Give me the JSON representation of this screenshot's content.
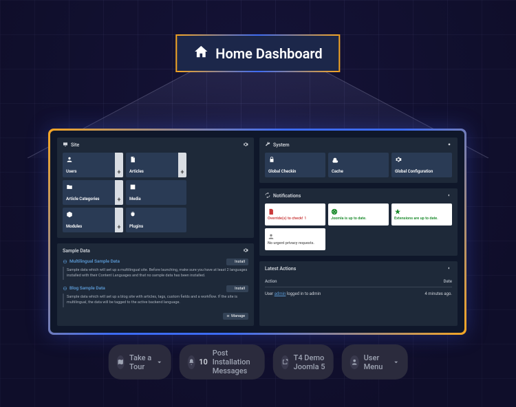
{
  "badge": {
    "label": "Home Dashboard"
  },
  "site": {
    "title": "Site",
    "cards": [
      {
        "label": "Users"
      },
      {
        "label": "Articles"
      },
      {
        "label": "Article Categories"
      },
      {
        "label": "Media"
      },
      {
        "label": "Modules"
      },
      {
        "label": "Plugins"
      }
    ]
  },
  "system": {
    "title": "System",
    "cards": [
      {
        "label": "Global Checkin"
      },
      {
        "label": "Cache"
      },
      {
        "label": "Global Configuration"
      }
    ]
  },
  "sample": {
    "title": "Sample Data",
    "items": [
      {
        "title": "Multilingual Sample Data",
        "desc": "Sample data which will set up a multilingual site.\nBefore launching, make sure you have at least 2 languages installed with their Content Languages and that no sample data has been installed.",
        "install_label": "Install"
      },
      {
        "title": "Blog Sample Data",
        "desc": "Sample data which will set up a blog site with articles, tags, custom fields and a workflow.\nIf the site is multilingual, the data will be tagged to the active backend language.",
        "install_label": "Install"
      }
    ],
    "manage_label": "Manage"
  },
  "notifications": {
    "title": "Notifications",
    "cards": [
      {
        "text": "Override(s) to check!",
        "count": "1",
        "tone": "red"
      },
      {
        "text": "Joomla is up to date.",
        "tone": "green"
      },
      {
        "text": "Extensions are up to date.",
        "tone": "green"
      },
      {
        "text": "No urgent privacy requests.",
        "tone": "gray"
      }
    ]
  },
  "latest": {
    "title": "Latest Actions",
    "cols": {
      "action": "Action",
      "date": "Date"
    },
    "rows": [
      {
        "action_prefix": "User ",
        "action_link": "admin",
        "action_suffix": " logged in to admin",
        "date": "4 minutes ago."
      }
    ]
  },
  "pills": {
    "tour": "Take a Tour",
    "post_install_count": "10",
    "post_install_label": "Post Installation Messages",
    "site_label": "T4 Demo Joomla 5",
    "user_label": "User Menu"
  }
}
